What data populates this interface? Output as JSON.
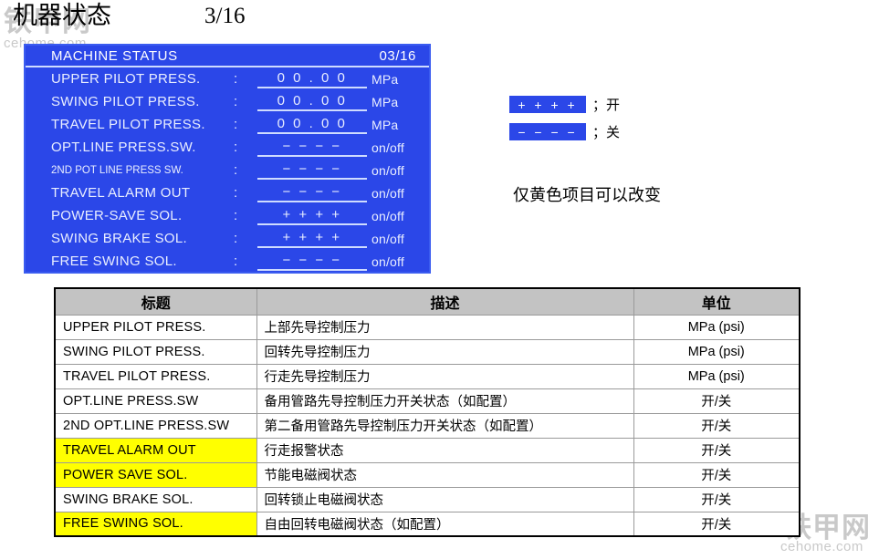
{
  "watermark": {
    "cn": "铁甲网",
    "en": "cehome.com"
  },
  "header": {
    "title": "机器状态",
    "page_number": "3/16"
  },
  "monitor": {
    "header_title": "MACHINE STATUS",
    "header_page": "03/16",
    "colon": ":",
    "rows": [
      {
        "label": "UPPER PILOT PRESS.",
        "value": "0 0 . 0 0",
        "unit": "MPa",
        "small": false
      },
      {
        "label": "SWING PILOT PRESS.",
        "value": "0 0 . 0 0",
        "unit": "MPa",
        "small": false
      },
      {
        "label": "TRAVEL PILOT PRESS.",
        "value": "0 0 . 0 0",
        "unit": "MPa",
        "small": false
      },
      {
        "label": "OPT.LINE PRESS.SW.",
        "value": "− − − −",
        "unit": "on/off",
        "small": false
      },
      {
        "label": "2ND POT LINE PRESS SW.",
        "value": "− − − −",
        "unit": "on/off",
        "small": true
      },
      {
        "label": "TRAVEL ALARM OUT",
        "value": "− − − −",
        "unit": "on/off",
        "small": false
      },
      {
        "label": "POWER-SAVE SOL.",
        "value": "+ + + +",
        "unit": "on/off",
        "small": false
      },
      {
        "label": "SWING BRAKE SOL.",
        "value": "+ + + +",
        "unit": "on/off",
        "small": false
      },
      {
        "label": "FREE SWING SOL.",
        "value": "− − − −",
        "unit": "on/off",
        "small": false
      }
    ]
  },
  "legend": {
    "on_swatch": "+ + + +",
    "on_text": "；开",
    "off_swatch": "− − − −",
    "off_text": "；关",
    "note": "仅黄色项目可以改变"
  },
  "table": {
    "headers": {
      "title": "标题",
      "description": "描述",
      "unit": "单位"
    },
    "rows": [
      {
        "title": "UPPER  PILOT  PRESS.",
        "description": "上部先导控制压力",
        "unit": "MPa (psi)",
        "highlight": false
      },
      {
        "title": "SWING  PILOT  PRESS.",
        "description": "回转先导控制压力",
        "unit": "MPa (psi)",
        "highlight": false
      },
      {
        "title": "TRAVEL  PILOT  PRESS.",
        "description": "行走先导控制压力",
        "unit": "MPa (psi)",
        "highlight": false
      },
      {
        "title": "OPT.LINE  PRESS.SW",
        "description": "备用管路先导控制压力开关状态（如配置）",
        "unit": "开/关",
        "highlight": false
      },
      {
        "title": "2ND OPT.LINE  PRESS.SW",
        "description": "第二备用管路先导控制压力开关状态（如配置）",
        "unit": "开/关",
        "highlight": false
      },
      {
        "title": "TRAVEL  ALARM  OUT",
        "description": "行走报警状态",
        "unit": "开/关",
        "highlight": true
      },
      {
        "title": "POWER SAVE SOL.",
        "description": "节能电磁阀状态",
        "unit": "开/关",
        "highlight": true
      },
      {
        "title": "SWING BRAKE SOL.",
        "description": "回转锁止电磁阀状态",
        "unit": "开/关",
        "highlight": false
      },
      {
        "title": "FREE SWING  SOL.",
        "description": "自由回转电磁阀状态（如配置）",
        "unit": "开/关",
        "highlight": true
      }
    ]
  },
  "colors": {
    "panel_blue": "#2b47e8",
    "highlight_yellow": "#ffff00",
    "table_header_grey": "#c3c3c3",
    "watermark_grey": "#c9c9c9"
  }
}
